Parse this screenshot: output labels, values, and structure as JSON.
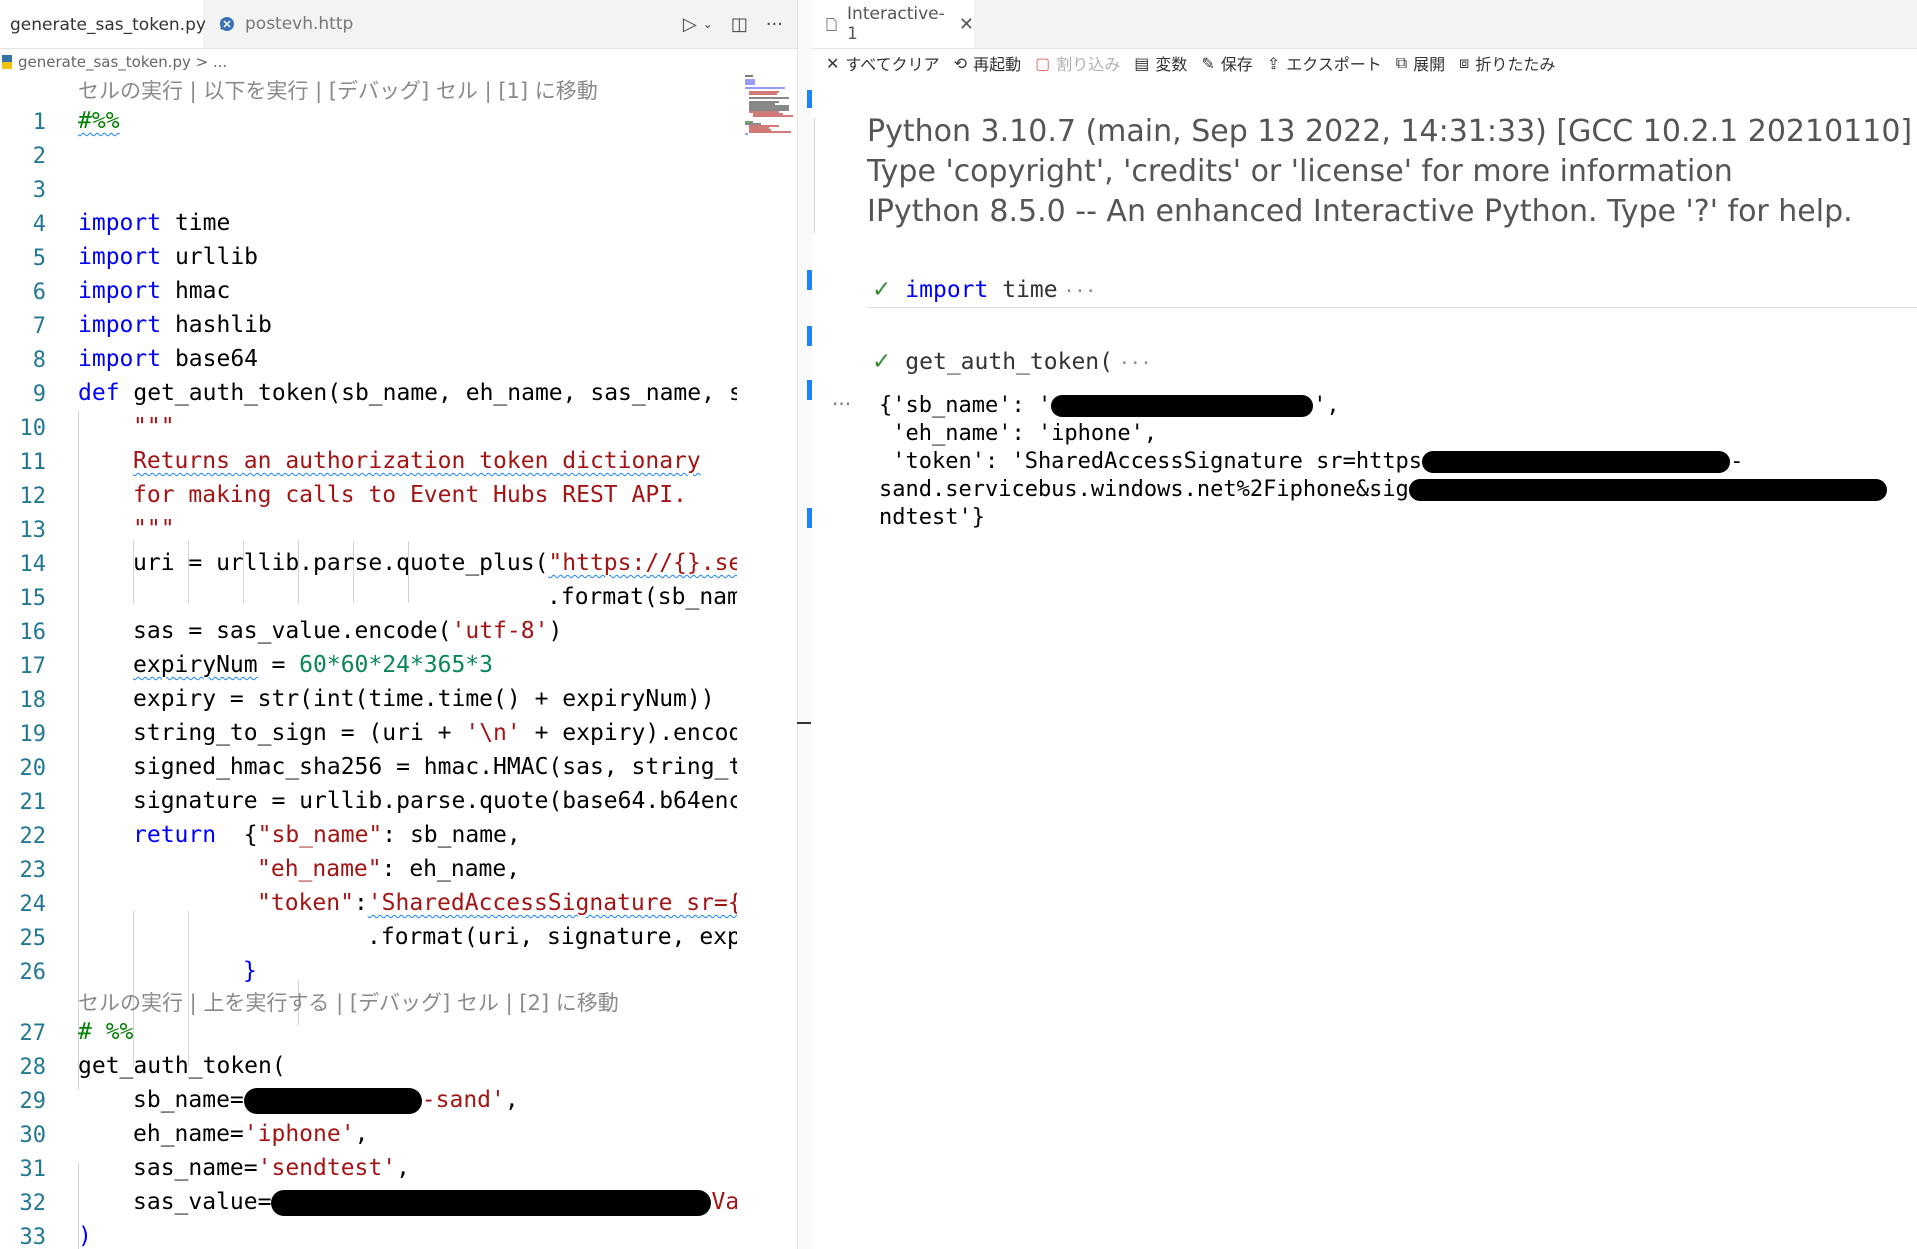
{
  "editor": {
    "tabs": [
      {
        "label": "generate_sas_token.py",
        "active": true
      },
      {
        "label": "postevh.http",
        "active": false
      }
    ],
    "breadcrumb": "generate_sas_token.py > ...",
    "codelens": [
      "セルの実行 | 以下を実行 | [デバッグ] セル | [1] に移動",
      "セルの実行 | 上を実行する | [デバッグ] セル | [2] に移動"
    ],
    "line_numbers": [
      "1",
      "2",
      "3",
      "4",
      "5",
      "6",
      "7",
      "8",
      "9",
      "10",
      "11",
      "12",
      "13",
      "14",
      "15",
      "16",
      "17",
      "18",
      "19",
      "20",
      "21",
      "22",
      "23",
      "24",
      "25",
      "26",
      "27",
      "28",
      "29",
      "30",
      "31",
      "32",
      "33"
    ],
    "code": {
      "l1": "#%%",
      "l3_kw": "import",
      "l3": " time",
      "l4_kw": "import",
      "l4": " urllib",
      "l5_kw": "import",
      "l5": " hmac",
      "l6_kw": "import",
      "l6": " hashlib",
      "l7_kw": "import",
      "l7": " base64",
      "l9_kw": "def",
      "l9": " get_auth_token(sb_name, eh_name, sas_name, s",
      "l10": "\"\"\"",
      "l11": "Returns an authorization token dictionary",
      "l12": "for making calls to Event Hubs REST API.",
      "l13": "\"\"\"",
      "l14a": "uri = urllib.parse.quote_plus(",
      "l14b": "\"https://{}.se",
      "l15": ".format(sb_nam",
      "l16a": "sas = sas_value.encode(",
      "l16b": "'utf-8'",
      "l16c": ")",
      "l17a": "expiryNum",
      "l17b": " = ",
      "l17c": "60*60*24*365*3",
      "l18": "expiry = str(int(time.time() + expiryNum))",
      "l19a": "string_to_sign = (uri + ",
      "l19b": "'\\n'",
      "l19c": " + expiry).encod",
      "l20": "signed_hmac_sha256 = hmac.HMAC(sas, string_t",
      "l21": "signature = urllib.parse.quote(base64.b64enc",
      "l22_kw": "return",
      "l22a": "  {",
      "l22b": "\"sb_name\"",
      "l22c": ": sb_name,",
      "l23a": "\"eh_name\"",
      "l23b": ": eh_name,",
      "l24a": "\"token\"",
      "l24b": ":",
      "l24c": "'SharedAccessSignature sr={",
      "l25": ".format(uri, signature, exp",
      "l26": "}",
      "l27": "# %%",
      "l28": "get_auth_token(",
      "l29a": "sb_name=",
      "l29b": "-sand'",
      "l29c": ",",
      "l30a": "eh_name=",
      "l30b": "'iphone'",
      "l30c": ",",
      "l31a": "sas_name=",
      "l31b": "'sendtest'",
      "l31c": ",",
      "l32a": "sas_value=",
      "l32b": "Va",
      "l33": ")"
    }
  },
  "interactive": {
    "tab_label": "Interactive-1",
    "toolbar": [
      {
        "icon": "✕",
        "label": "すべてクリア",
        "disabled": false
      },
      {
        "icon": "⟲",
        "label": "再起動",
        "disabled": false
      },
      {
        "icon": "▢",
        "label": "割り込み",
        "disabled": true
      },
      {
        "icon": "▤",
        "label": "変数",
        "disabled": false
      },
      {
        "icon": "✎",
        "label": "保存",
        "disabled": false
      },
      {
        "icon": "⇪",
        "label": "エクスポート",
        "disabled": false
      },
      {
        "icon": "⧉",
        "label": "展開",
        "disabled": false
      },
      {
        "icon": "⧈",
        "label": "折りたたみ",
        "disabled": false
      }
    ],
    "banner": [
      "Python 3.10.7 (main, Sep 13 2022, 14:31:33) [GCC 10.2.1 20210110]",
      "Type 'copyright', 'credits' or 'license' for more information",
      "IPython 8.5.0 -- An enhanced Interactive Python. Type '?' for help."
    ],
    "cells": [
      {
        "status": "✓",
        "code_kw": "import",
        "code": " time",
        "more": "···"
      },
      {
        "status": "✓",
        "code_kw": "",
        "code": "get_auth_token(",
        "more": "···"
      }
    ],
    "output_ellipsis": "···",
    "output": {
      "l1a": "{'sb_name': '",
      "l1b": "',",
      "l2": " 'eh_name': 'iphone',",
      "l3a": " 'token': 'SharedAccessSignature sr=https",
      "l3b": "-",
      "l4a": "sand.servicebus.windows.net%2Fiphone&sig",
      "l5": "ndtest'}"
    }
  },
  "colors": {
    "keyword": "#0000ff",
    "string": "#a31515",
    "comment": "#008000",
    "number": "#098658",
    "line_number": "#237893",
    "accent": "#1a85ff",
    "check": "#388a34"
  }
}
